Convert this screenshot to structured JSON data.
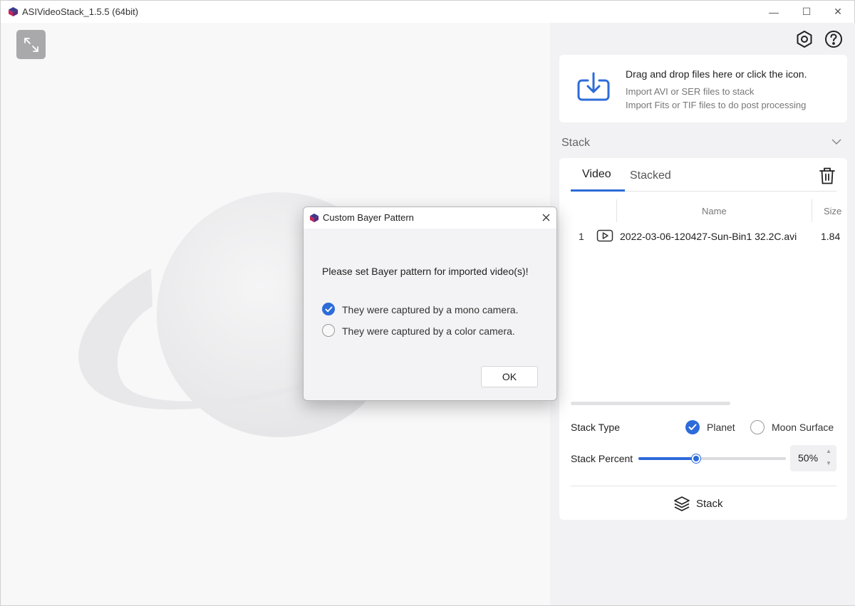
{
  "window": {
    "title": "ASIVideoStack_1.5.5 (64bit)",
    "controls": {
      "minimize": "—",
      "maximize": "☐",
      "close": "✕"
    }
  },
  "preview": {
    "expand_icon": "expand-arrows-icon"
  },
  "toolbar": {
    "settings_icon": "settings-icon",
    "help_icon": "help-icon"
  },
  "import": {
    "title": "Drag and drop files here or click the icon.",
    "line1": "Import AVI or SER files to stack",
    "line2": "Import Fits or TIF files to do post processing",
    "icon": "download-icon"
  },
  "stack_section": {
    "title": "Stack",
    "tabs": [
      {
        "label": "Video",
        "active": true
      },
      {
        "label": "Stacked",
        "active": false
      }
    ],
    "columns": {
      "name": "Name",
      "size": "Size"
    },
    "rows": [
      {
        "index": "1",
        "name": "2022-03-06-120427-Sun-Bin1 32.2C.avi",
        "size": "1.84"
      }
    ],
    "stack_type": {
      "label": "Stack Type",
      "options": [
        {
          "label": "Planet",
          "selected": true
        },
        {
          "label": "Moon Surface",
          "selected": false
        }
      ]
    },
    "stack_percent": {
      "label": "Stack Percent",
      "value": 50,
      "display": "50%"
    },
    "stack_button": "Stack"
  },
  "dialog": {
    "title": "Custom Bayer Pattern",
    "prompt": "Please set Bayer pattern for imported video(s)!",
    "options": [
      {
        "label": "They were captured by a mono camera.",
        "selected": true
      },
      {
        "label": "They were captured by a color camera.",
        "selected": false
      }
    ],
    "ok": "OK",
    "close": "✕"
  },
  "colors": {
    "accent": "#2d6bd9",
    "panel_bg": "#f2f2f4",
    "card_bg": "#ffffff"
  }
}
